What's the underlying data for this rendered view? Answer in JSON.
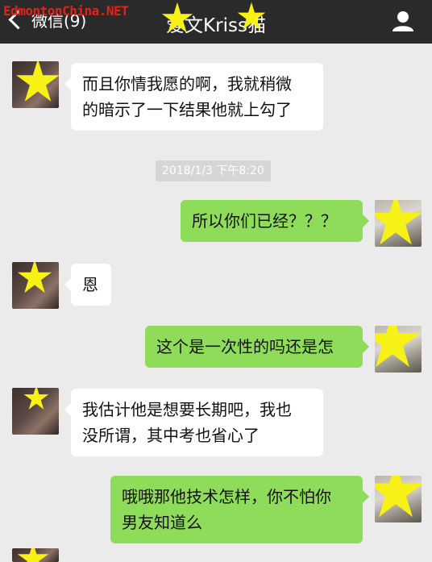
{
  "watermark": "EdmontonChina.NET",
  "header": {
    "back_label": "微信(9)",
    "title": "爱文Kriss猫",
    "profile_icon": "person-icon"
  },
  "colors": {
    "header_bg": "#2a2a2b",
    "chat_bg": "#ebebeb",
    "incoming_bubble": "#ffffff",
    "outgoing_bubble": "#8fdc5a",
    "censor_star": "#f7f115",
    "watermark": "#e2231a"
  },
  "timestamp": "2018/1/3 下午8:20",
  "messages": [
    {
      "direction": "in",
      "lines": [
        "而且你情我愿的啊，我就稍微",
        "的暗示了一下结果他就上勾了"
      ]
    },
    {
      "direction": "out",
      "lines": [
        "所以你们已经？？？"
      ]
    },
    {
      "direction": "in",
      "lines": [
        "恩"
      ]
    },
    {
      "direction": "out",
      "lines": [
        "这个是一次性的吗还是怎"
      ]
    },
    {
      "direction": "in",
      "lines": [
        "我估计他是想要长期吧，我也",
        "没所谓，其中考也省心了"
      ]
    },
    {
      "direction": "out",
      "lines": [
        "哦哦那他技术怎样，你不怕你",
        "男友知道么"
      ]
    }
  ]
}
